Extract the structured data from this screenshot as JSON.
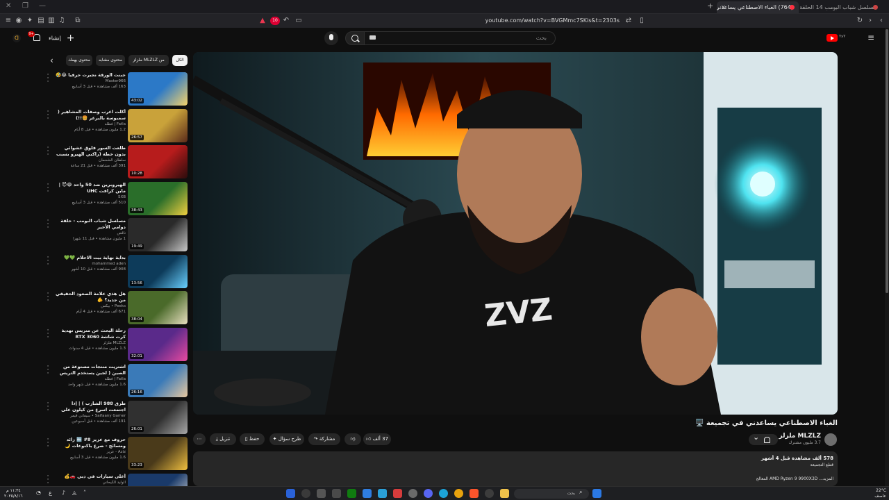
{
  "browser": {
    "tabs": [
      {
        "title": "(764) الغباء الاصطناعي يساعدني ...",
        "active": true
      },
      {
        "title": "مسلسل شباب البومب 14 الحلقة 12 ال...",
        "active": false
      }
    ],
    "url": "youtube.com/watch?v=BVGMmc7SKis&t=2303s",
    "ad_count": "10"
  },
  "header": {
    "search_placeholder": "بحث",
    "create_label": "إنشاء",
    "notification_badge": "9+",
    "brand_text": "ᵀˢᵀ"
  },
  "sidebar": {
    "chips": [
      "الكل",
      "من MLZLZ ملزلز",
      "محتوى مشابه",
      "محتوى يهمك"
    ],
    "recs": [
      {
        "title": "جبنت الورقة نجبرت حرفيا 😂🤣",
        "channel": "Master966",
        "stats": "163 ألف مشاهدة • قبل 3 أسابيع",
        "duration": "43:02"
      },
      {
        "title": "أكلت اغرب وصفات المشاهير ( سمبوسة بالبرغر 🍔!!)",
        "channel": "Fatla | فطله",
        "stats": "1.2 مليون مشاهدة • قبل 8 أيام",
        "duration": "26:57"
      },
      {
        "title": "طلعت السور فلوق عشوائي بدون خطة (راكبي الهيرو بسبب متواصل 😂🚢 )",
        "channel": "سلطان الشحمان",
        "stats": "391 ألف مشاهدة • قبل 21 ساعة",
        "duration": "10:28"
      },
      {
        "title": "الهيروبرين ضد 50 واحد 😂😈 | ماين كرافت UHC",
        "channel": "SXB",
        "stats": "510 ألف مشاهدة • قبل 3 أسابيع",
        "duration": "38:43"
      },
      {
        "title": "مسلسل شباب البومب - حلقة دوامي الأخير",
        "channel": "ناقص",
        "stats": "1 مليون مشاهدة • قبل 11 شهرا",
        "duration": "19:49"
      },
      {
        "title": "بداية نهاية بيت الاحلام 💚💚",
        "channel": "mohammed aden",
        "stats": "908 ألف مشاهدة • قبل 10 أشهر",
        "duration": "13:56"
      },
      {
        "title": "هل هذي علامة الصعود الحقيقي من جديد؟ 🫵",
        "channel": "Peeks • بيكس",
        "stats": "671 ألف مشاهدة • قبل 4 أيام",
        "duration": "38:04"
      },
      {
        "title": "رحلة البحث عن متريس تهدية كرت شاشة RTX 3060",
        "channel": "MLZLZ ملزلز",
        "stats": "1.3 مليون مشاهدة • قبل 4 سنوات",
        "duration": "32:01"
      },
      {
        "title": "اشتريت منتجات مستوعة من الصين ( لجين يستخدم التريس !!)",
        "channel": "Fatla | فطله",
        "stats": "1.6 مليون مشاهدة • قبل شهر واحد",
        "duration": "26:16"
      },
      {
        "title": "طرق 988 الشارب ) | إذا اجتمعت اسرع من كيلون على اللدن وحصو وقال ماشرته",
        "channel": "Saifaany Gamer • سيفاني قيمر",
        "stats": "191 ألف مشاهدة • قبل أسبوعين",
        "duration": "26:01"
      },
      {
        "title": "حروف مع عزيز 8# 🔤 زائد ومسائح - ضرع باكنوعات 🌙 الموسم الثالث",
        "channel": "Aziz - عزيز",
        "stats": "1.6 مليون مشاهدة • قبل 3 أسابيع",
        "duration": "33:23"
      },
      {
        "title": "أغلى سيارات في دبي 🚗💰",
        "channel": "الوليد الكيحاني",
        "stats": "",
        "duration": ""
      }
    ]
  },
  "video": {
    "title": "الغباء الاصطناعي يساعدني في تجميعة 🖥️",
    "channel_name": "MLZLZ ملزلز",
    "subscribers": "3.7 مليون مشترك",
    "like_count": "37 ألف",
    "actions": {
      "share": "مشاركة",
      "ask": "طرح سؤال",
      "save": "حفظ",
      "download": "تنزيل",
      "more": "⋯"
    },
    "description": {
      "views": "578 ألف مشاهدة قبل 4 أشهر",
      "line2": "قطع التجميعة",
      "line3": "المعالج AMD Ryzen 9 9900X3D ...المزيد"
    }
  },
  "taskbar": {
    "time": "١١:٣٤ م",
    "date": "٢٠٢٥/٨/١٦",
    "weather_temp": "22°C",
    "weather_desc": "عاصف",
    "search_label": "بحث"
  }
}
